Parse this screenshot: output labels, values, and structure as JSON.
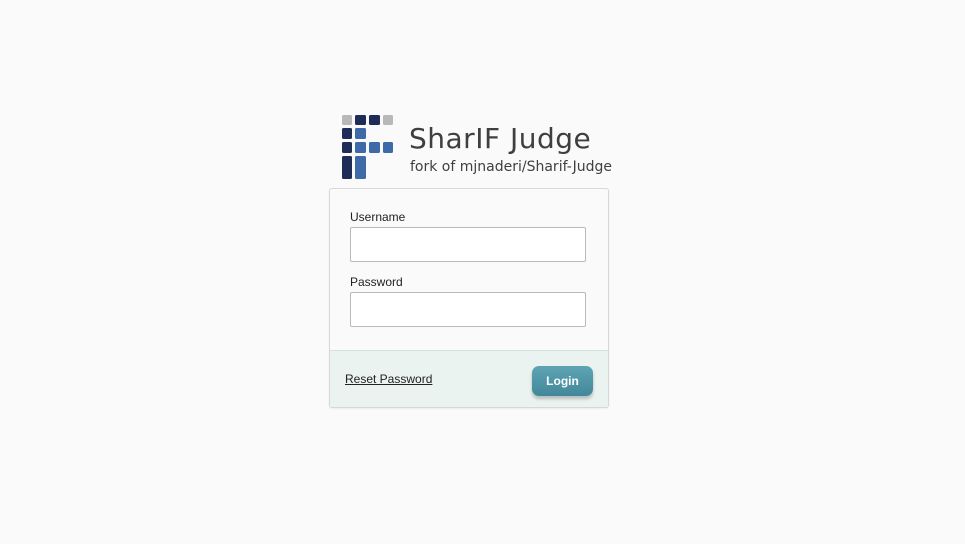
{
  "brand": {
    "title": "SharIF Judge",
    "subtitle": "fork of mjnaderi/Sharif-Judge",
    "logo_icon": "sharif-judge-logo-icon",
    "colors": {
      "dark_navy": "#1d2d57",
      "mid_blue": "#3e6ba7",
      "grey": "#b8b8b8"
    }
  },
  "login_form": {
    "username_label": "Username",
    "username_value": "",
    "password_label": "Password",
    "password_value": "",
    "reset_link": "Reset Password",
    "login_button": "Login"
  },
  "theme": {
    "page_background": "#fafafa",
    "footer_background": "#eaf3f0",
    "button_color": "#4e96a8"
  }
}
